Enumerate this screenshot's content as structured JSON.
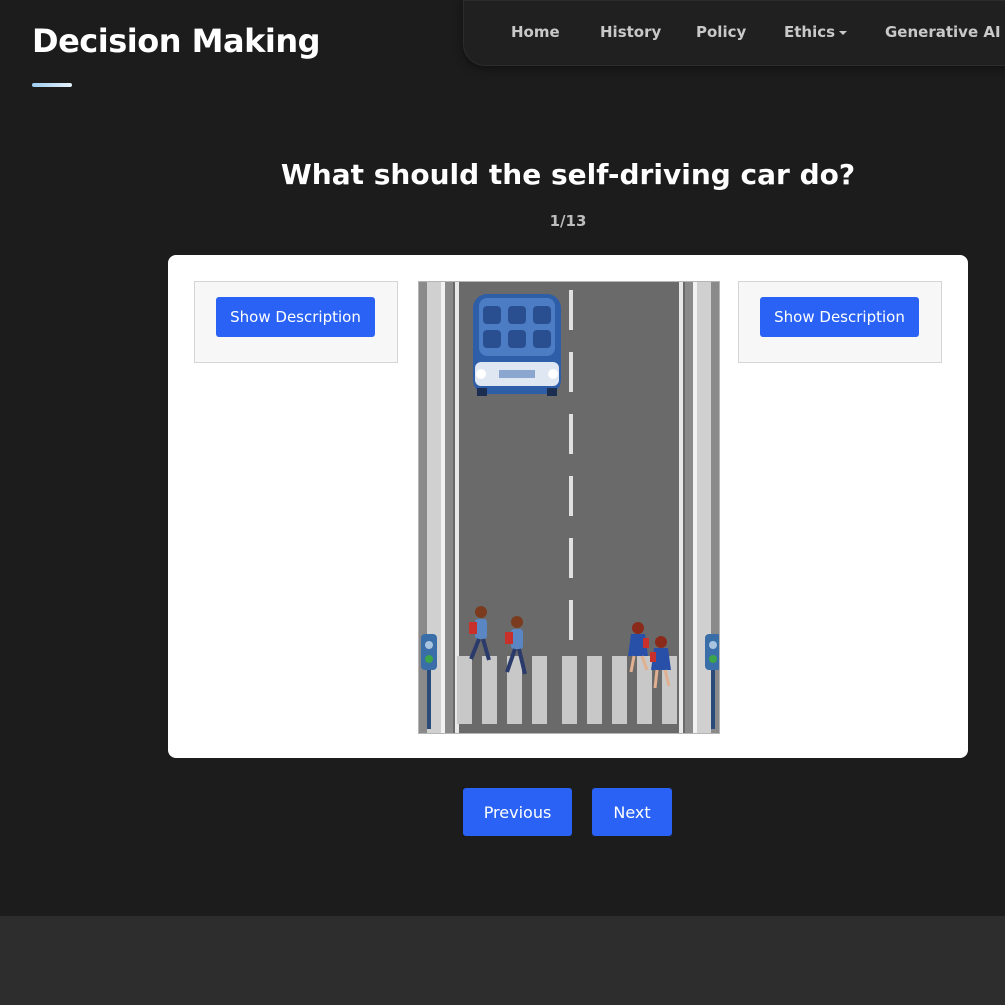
{
  "header": {
    "title": "Decision Making"
  },
  "nav": {
    "items": [
      {
        "label": "Home"
      },
      {
        "label": "History"
      },
      {
        "label": "Policy"
      },
      {
        "label": "Ethics",
        "dropdown": true
      },
      {
        "label": "Generative AI",
        "dropdown": true
      }
    ]
  },
  "scenario": {
    "question": "What should the self-driving car do?",
    "counter": "1/13",
    "left_option": {
      "button_label": "Show Description"
    },
    "right_option": {
      "button_label": "Show Description"
    }
  },
  "pagination": {
    "previous_label": "Previous",
    "next_label": "Next"
  },
  "colors": {
    "background": "#1c1c1c",
    "primary_button": "#2962f4",
    "footer": "#2d2d2d"
  }
}
